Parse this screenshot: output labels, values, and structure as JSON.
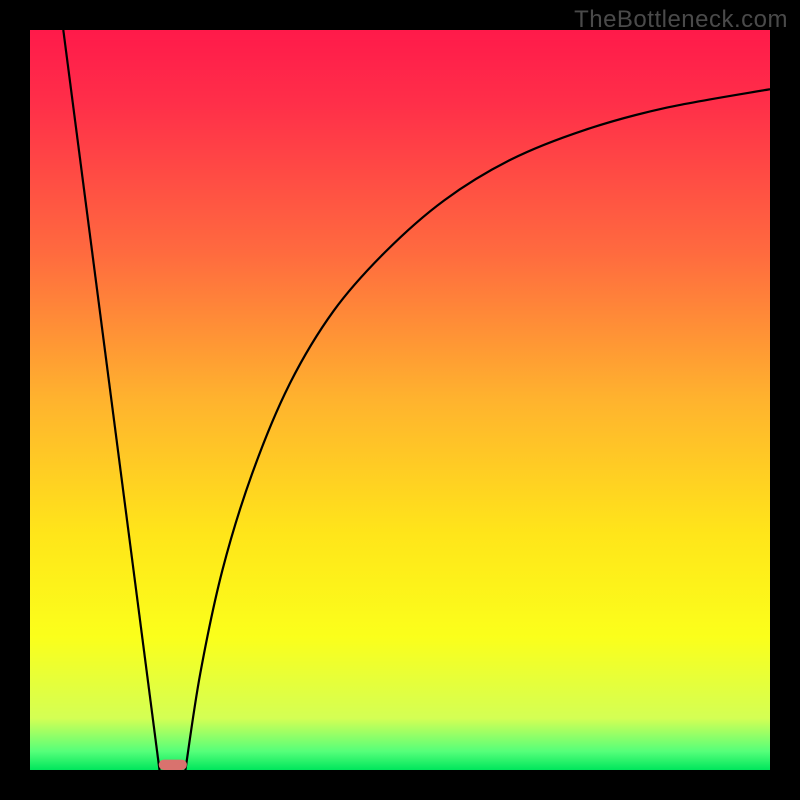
{
  "watermark": "TheBottleneck.com",
  "chart_data": {
    "type": "line",
    "title": "",
    "xlabel": "",
    "ylabel": "",
    "xlim": [
      0,
      100
    ],
    "ylim": [
      0,
      100
    ],
    "gradient_stops": [
      {
        "offset": 0.0,
        "color": "#ff1a4a"
      },
      {
        "offset": 0.1,
        "color": "#ff2f49"
      },
      {
        "offset": 0.3,
        "color": "#ff6a3f"
      },
      {
        "offset": 0.5,
        "color": "#ffb32e"
      },
      {
        "offset": 0.68,
        "color": "#ffe51a"
      },
      {
        "offset": 0.82,
        "color": "#fbff1b"
      },
      {
        "offset": 0.93,
        "color": "#d4ff54"
      },
      {
        "offset": 0.975,
        "color": "#55ff7a"
      },
      {
        "offset": 1.0,
        "color": "#00e65c"
      }
    ],
    "series": [
      {
        "name": "left-descent",
        "x": [
          4.5,
          17.5
        ],
        "values": [
          100,
          0
        ]
      },
      {
        "name": "right-curve",
        "x": [
          21,
          23,
          26,
          30,
          35,
          41,
          48,
          56,
          65,
          75,
          86,
          100
        ],
        "values": [
          0,
          13,
          27,
          40,
          52,
          62,
          70,
          77,
          82.5,
          86.5,
          89.5,
          92
        ]
      }
    ],
    "marker": {
      "name": "bottleneck-marker",
      "x_center": 19.3,
      "width": 3.8,
      "height": 1.4,
      "color": "#d9726e"
    },
    "plot_bg": "#000000",
    "curve_color": "#000000"
  }
}
